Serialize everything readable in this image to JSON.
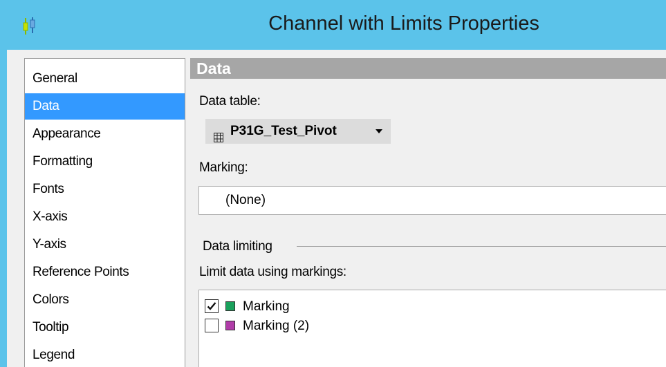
{
  "window": {
    "title": "Channel with Limits Properties"
  },
  "nav": {
    "items": [
      {
        "label": "General",
        "selected": false
      },
      {
        "label": "Data",
        "selected": true
      },
      {
        "label": "Appearance",
        "selected": false
      },
      {
        "label": "Formatting",
        "selected": false
      },
      {
        "label": "Fonts",
        "selected": false
      },
      {
        "label": "X-axis",
        "selected": false
      },
      {
        "label": "Y-axis",
        "selected": false
      },
      {
        "label": "Reference Points",
        "selected": false
      },
      {
        "label": "Colors",
        "selected": false
      },
      {
        "label": "Tooltip",
        "selected": false
      },
      {
        "label": "Legend",
        "selected": false
      }
    ]
  },
  "data_section": {
    "header": "Data",
    "data_table_label": "Data table:",
    "data_table_value": "P31G_Test_Pivot",
    "marking_label": "Marking:",
    "marking_value": "(None)",
    "data_limiting_label": "Data limiting",
    "limit_label": "Limit data using markings:",
    "markings": [
      {
        "label": "Marking",
        "checked": true,
        "color": "#1aa15c"
      },
      {
        "label": "Marking (2)",
        "checked": false,
        "color": "#b03ca8"
      }
    ]
  },
  "colors": {
    "titlebar": "#5bc3ea",
    "selection": "#3399ff",
    "section_header": "#a6a6a6"
  },
  "icons": {
    "app": "channel-limits-chart-icon",
    "data_table": "grid-table-icon",
    "dropdown": "triangle-down-icon",
    "check": "checkmark-icon"
  }
}
